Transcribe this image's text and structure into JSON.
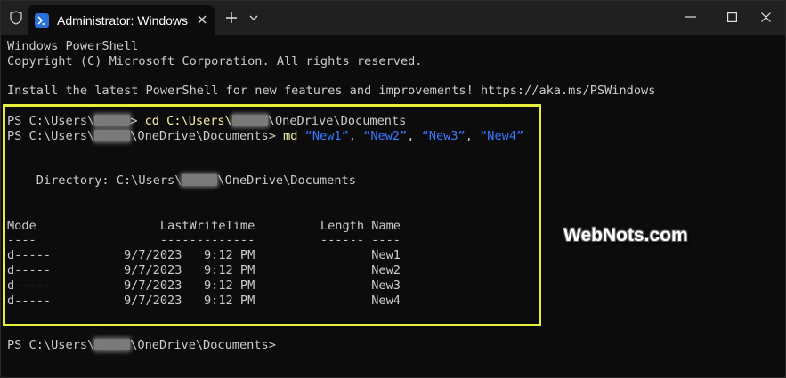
{
  "window": {
    "tab_title": "Administrator: Windows PowerShell",
    "icons": {
      "shield": "shield-icon",
      "tab": "powershell-icon",
      "close_tab": "close-icon",
      "new_tab": "plus-icon",
      "dropdown": "chevron-down-icon",
      "minimize": "minimize-icon",
      "maximize": "maximize-icon",
      "close": "close-icon"
    }
  },
  "terminal": {
    "banner": [
      "Windows PowerShell",
      "Copyright (C) Microsoft Corporation. All rights reserved.",
      "",
      "Install the latest PowerShell for new features and improvements! https://aka.ms/PSWindows"
    ],
    "prompt_prefix": "PS C:\\Users\\",
    "prompt1_suffix": "> ",
    "cmd1": "cd C:\\Users\\",
    "cmd1_suffix": "\\OneDrive\\Documents",
    "prompt2_suffix": "\\OneDrive\\Documents> ",
    "cmd2_name": "md ",
    "cmd2_args": [
      "“New1”",
      "“New2”",
      "“New3”",
      "“New4”"
    ],
    "directory_label": "    Directory: C:\\Users\\",
    "directory_suffix": "\\OneDrive\\Documents",
    "header": "Mode                 LastWriteTime         Length Name",
    "underline": "----                 -------------         ------ ----",
    "rows": [
      "d-----          9/7/2023   9:12 PM                New1",
      "d-----          9/7/2023   9:12 PM                New2",
      "d-----          9/7/2023   9:12 PM                New3",
      "d-----          9/7/2023   9:12 PM                New4"
    ],
    "final_prompt_suffix": "\\OneDrive\\Documents>"
  },
  "watermark": "WebNots.com",
  "colors": {
    "highlight_border": "#e8ef3a",
    "command": "#f9f1a5",
    "string_arg": "#3b78ff",
    "text": "#cccccc",
    "background": "#0c0c0c"
  }
}
